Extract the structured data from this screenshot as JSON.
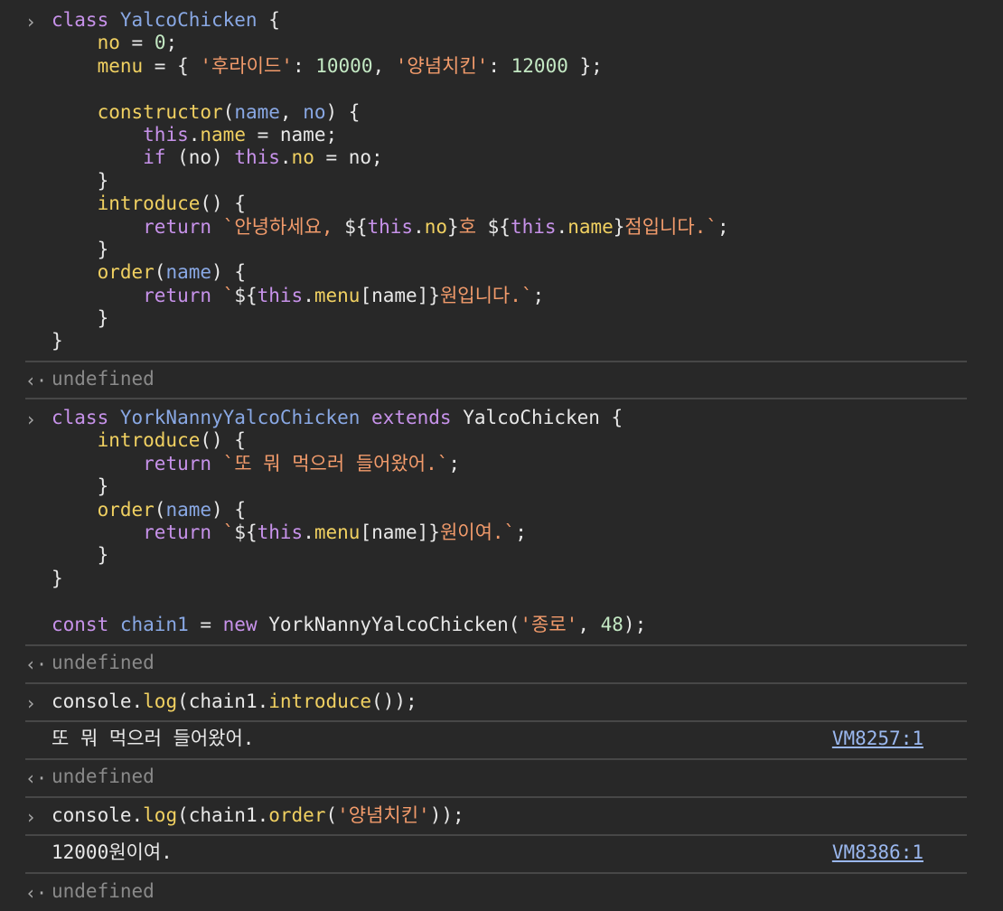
{
  "prompt_symbol": "›",
  "result_symbol": "‹·",
  "entries": [
    {
      "type": "input",
      "lines": [
        [
          [
            "k",
            "class "
          ],
          [
            "cls",
            "YalcoChicken"
          ],
          [
            "p",
            " {"
          ]
        ],
        [
          [
            "p",
            "    "
          ],
          [
            "prop",
            "no"
          ],
          [
            "p",
            " = "
          ],
          [
            "num",
            "0"
          ],
          [
            "p",
            ";"
          ]
        ],
        [
          [
            "p",
            "    "
          ],
          [
            "prop",
            "menu"
          ],
          [
            "p",
            " = { "
          ],
          [
            "str",
            "'후라이드'"
          ],
          [
            "p",
            ": "
          ],
          [
            "num",
            "10000"
          ],
          [
            "p",
            ", "
          ],
          [
            "str",
            "'양념치킨'"
          ],
          [
            "p",
            ": "
          ],
          [
            "num",
            "12000"
          ],
          [
            "p",
            " };"
          ]
        ],
        [
          [
            "p",
            ""
          ]
        ],
        [
          [
            "p",
            "    "
          ],
          [
            "fn",
            "constructor"
          ],
          [
            "p",
            "("
          ],
          [
            "par",
            "name"
          ],
          [
            "p",
            ", "
          ],
          [
            "par",
            "no"
          ],
          [
            "p",
            ") {"
          ]
        ],
        [
          [
            "p",
            "        "
          ],
          [
            "this",
            "this"
          ],
          [
            "p",
            "."
          ],
          [
            "prop",
            "name"
          ],
          [
            "p",
            " = name;"
          ]
        ],
        [
          [
            "p",
            "        "
          ],
          [
            "k",
            "if"
          ],
          [
            "p",
            " (no) "
          ],
          [
            "this",
            "this"
          ],
          [
            "p",
            "."
          ],
          [
            "prop",
            "no"
          ],
          [
            "p",
            " = no;"
          ]
        ],
        [
          [
            "p",
            "    }"
          ]
        ],
        [
          [
            "p",
            "    "
          ],
          [
            "fn",
            "introduce"
          ],
          [
            "p",
            "() {"
          ]
        ],
        [
          [
            "p",
            "        "
          ],
          [
            "k",
            "return"
          ],
          [
            "p",
            " "
          ],
          [
            "str",
            "`안녕하세요, "
          ],
          [
            "p",
            "${"
          ],
          [
            "this",
            "this"
          ],
          [
            "p",
            "."
          ],
          [
            "prop",
            "no"
          ],
          [
            "p",
            "}"
          ],
          [
            "str",
            "호 "
          ],
          [
            "p",
            "${"
          ],
          [
            "this",
            "this"
          ],
          [
            "p",
            "."
          ],
          [
            "prop",
            "name"
          ],
          [
            "p",
            "}"
          ],
          [
            "str",
            "점입니다.`"
          ],
          [
            "p",
            ";"
          ]
        ],
        [
          [
            "p",
            "    }"
          ]
        ],
        [
          [
            "p",
            "    "
          ],
          [
            "fn",
            "order"
          ],
          [
            "p",
            "("
          ],
          [
            "par",
            "name"
          ],
          [
            "p",
            ") {"
          ]
        ],
        [
          [
            "p",
            "        "
          ],
          [
            "k",
            "return"
          ],
          [
            "p",
            " "
          ],
          [
            "str",
            "`"
          ],
          [
            "p",
            "${"
          ],
          [
            "this",
            "this"
          ],
          [
            "p",
            "."
          ],
          [
            "prop",
            "menu"
          ],
          [
            "p",
            "[name]}"
          ],
          [
            "str",
            "원입니다.`"
          ],
          [
            "p",
            ";"
          ]
        ],
        [
          [
            "p",
            "    }"
          ]
        ],
        [
          [
            "p",
            "}"
          ]
        ]
      ]
    },
    {
      "type": "result",
      "text": "undefined"
    },
    {
      "type": "input",
      "lines": [
        [
          [
            "k",
            "class "
          ],
          [
            "cls",
            "YorkNannyYalcoChicken"
          ],
          [
            "p",
            " "
          ],
          [
            "k",
            "extends"
          ],
          [
            "p",
            " YalcoChicken {"
          ]
        ],
        [
          [
            "p",
            "    "
          ],
          [
            "fn",
            "introduce"
          ],
          [
            "p",
            "() {"
          ]
        ],
        [
          [
            "p",
            "        "
          ],
          [
            "k",
            "return"
          ],
          [
            "p",
            " "
          ],
          [
            "str",
            "`또 뭐 먹으러 들어왔어.`"
          ],
          [
            "p",
            ";"
          ]
        ],
        [
          [
            "p",
            "    }"
          ]
        ],
        [
          [
            "p",
            "    "
          ],
          [
            "fn",
            "order"
          ],
          [
            "p",
            "("
          ],
          [
            "par",
            "name"
          ],
          [
            "p",
            ") {"
          ]
        ],
        [
          [
            "p",
            "        "
          ],
          [
            "k",
            "return"
          ],
          [
            "p",
            " "
          ],
          [
            "str",
            "`"
          ],
          [
            "p",
            "${"
          ],
          [
            "this",
            "this"
          ],
          [
            "p",
            "."
          ],
          [
            "prop",
            "menu"
          ],
          [
            "p",
            "[name]}"
          ],
          [
            "str",
            "원이여.`"
          ],
          [
            "p",
            ";"
          ]
        ],
        [
          [
            "p",
            "    }"
          ]
        ],
        [
          [
            "p",
            "}"
          ]
        ],
        [
          [
            "p",
            ""
          ]
        ],
        [
          [
            "k",
            "const "
          ],
          [
            "par",
            "chain1"
          ],
          [
            "p",
            " = "
          ],
          [
            "k",
            "new"
          ],
          [
            "p",
            " YorkNannyYalcoChicken("
          ],
          [
            "str",
            "'종로'"
          ],
          [
            "p",
            ", "
          ],
          [
            "num",
            "48"
          ],
          [
            "p",
            ");"
          ]
        ]
      ]
    },
    {
      "type": "result",
      "text": "undefined"
    },
    {
      "type": "input",
      "lines": [
        [
          [
            "p",
            "console."
          ],
          [
            "fn",
            "log"
          ],
          [
            "p",
            "(chain1."
          ],
          [
            "fn",
            "introduce"
          ],
          [
            "p",
            "());"
          ]
        ]
      ]
    },
    {
      "type": "log",
      "text": "또 뭐 먹으러 들어왔어.",
      "source": "VM8257:1"
    },
    {
      "type": "result",
      "text": "undefined"
    },
    {
      "type": "input",
      "lines": [
        [
          [
            "p",
            "console."
          ],
          [
            "fn",
            "log"
          ],
          [
            "p",
            "(chain1."
          ],
          [
            "fn",
            "order"
          ],
          [
            "p",
            "("
          ],
          [
            "str",
            "'양념치킨'"
          ],
          [
            "p",
            "));"
          ]
        ]
      ]
    },
    {
      "type": "log",
      "text": "12000원이여.",
      "source": "VM8386:1"
    },
    {
      "type": "result",
      "text": "undefined"
    }
  ]
}
